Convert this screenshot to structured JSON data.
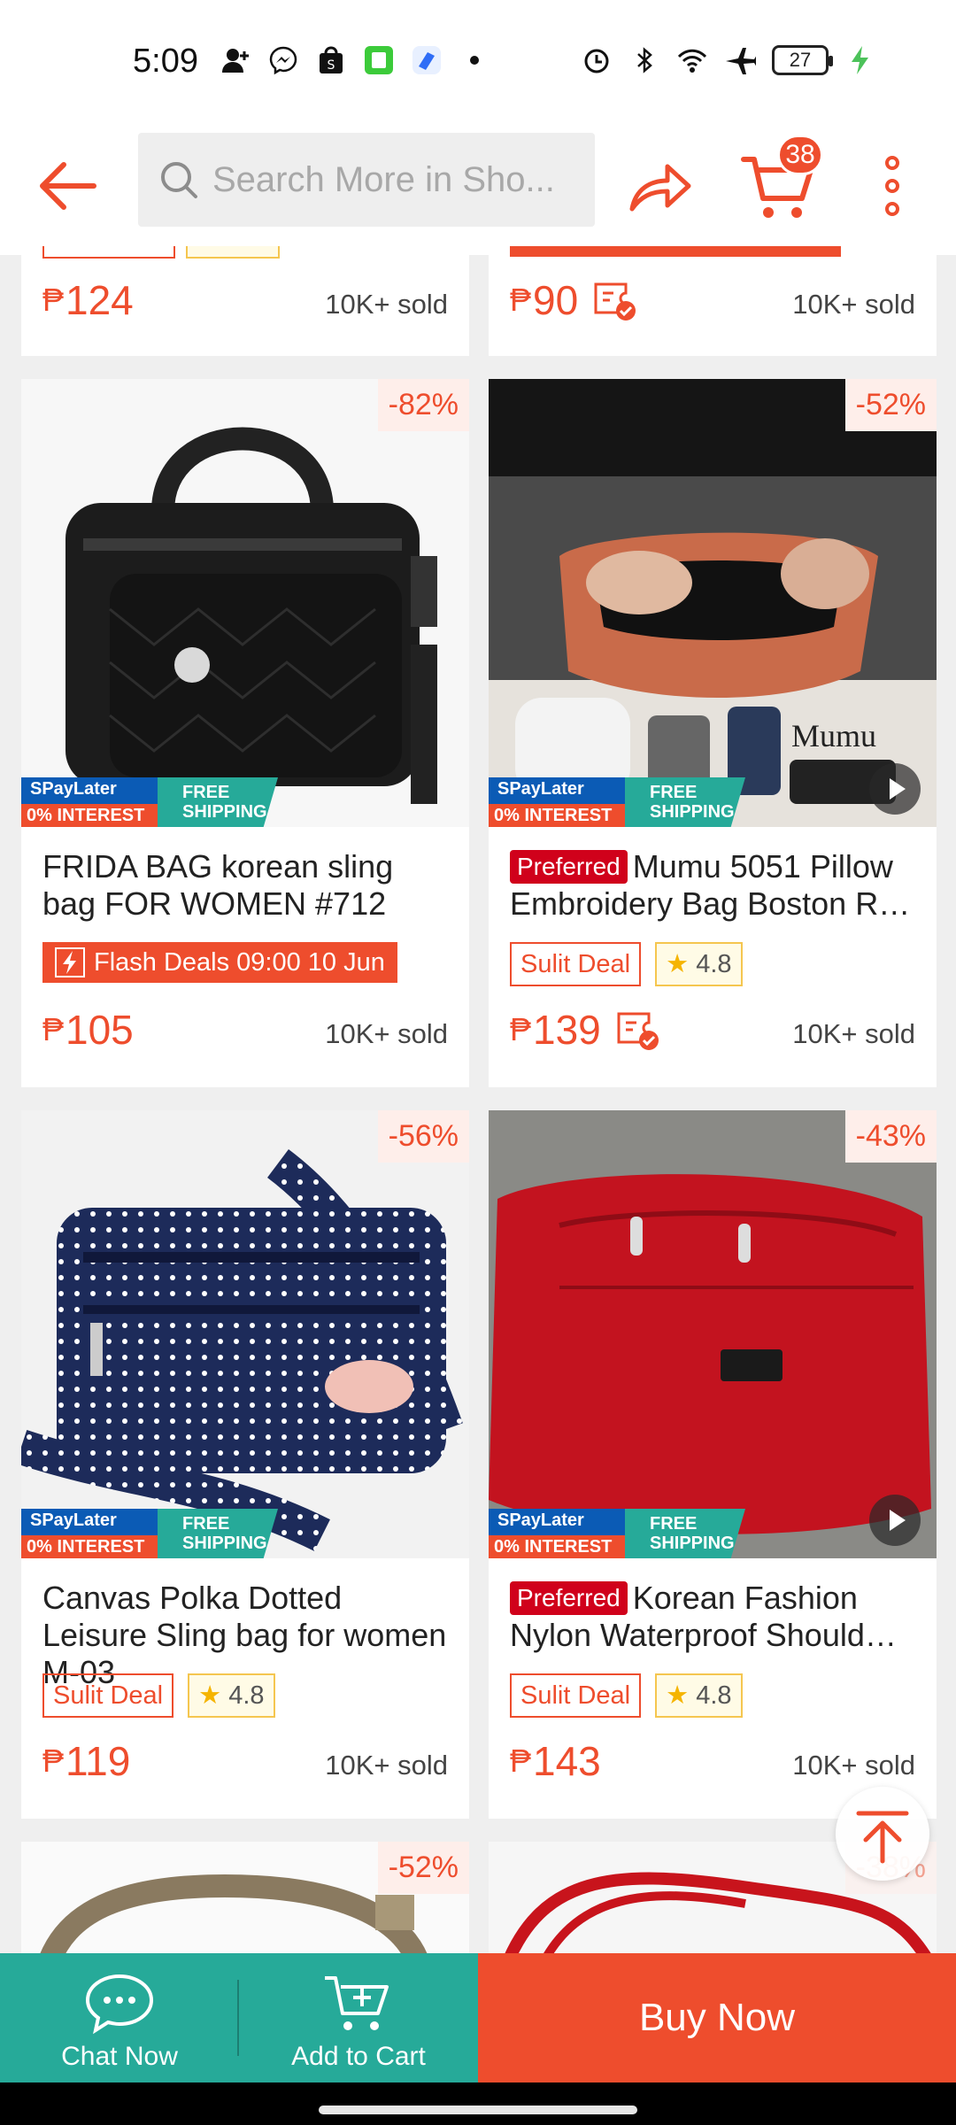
{
  "status_bar": {
    "time": "5:09",
    "battery": "27"
  },
  "header": {
    "search_placeholder": "Search More in Sho...",
    "cart_count": "38"
  },
  "products": [
    {
      "price": "124",
      "sold": "10K+ sold"
    },
    {
      "price": "90",
      "sold": "10K+ sold"
    },
    {
      "discount": "-82%",
      "title": "FRIDA BAG korean sling bag FOR WOMEN #712",
      "flash": "Flash Deals 09:00 10 Jun",
      "price": "105",
      "sold": "10K+ sold"
    },
    {
      "discount": "-52%",
      "preferred": "Preferred",
      "title": "Mumu 5051 Pillow Embroidery Bag Boston R…",
      "deal": "Sulit Deal",
      "rating": "4.8",
      "price": "139",
      "sold": "10K+ sold"
    },
    {
      "discount": "-56%",
      "title": "Canvas Polka Dotted Leisure Sling bag for women  M-03",
      "deal": "Sulit Deal",
      "rating": "4.8",
      "price": "119",
      "sold": "10K+ sold"
    },
    {
      "discount": "-43%",
      "preferred": "Preferred",
      "title": "Korean Fashion Nylon Waterproof Should…",
      "deal": "Sulit Deal",
      "rating": "4.8",
      "price": "143",
      "sold": "10K+ sold"
    },
    {
      "discount": "-52%"
    },
    {
      "discount": "-38%"
    }
  ],
  "promo": {
    "spay": "SPayLater",
    "interest": "0% INTEREST",
    "free_line1": "FREE",
    "free_line2": "SHIPPING"
  },
  "currency": "₱",
  "bottom_bar": {
    "chat": "Chat Now",
    "add_cart": "Add to Cart",
    "buy": "Buy Now"
  },
  "colors": {
    "brand": "#ee4d2d",
    "teal": "#26aa99",
    "preferred": "#d0011b"
  }
}
